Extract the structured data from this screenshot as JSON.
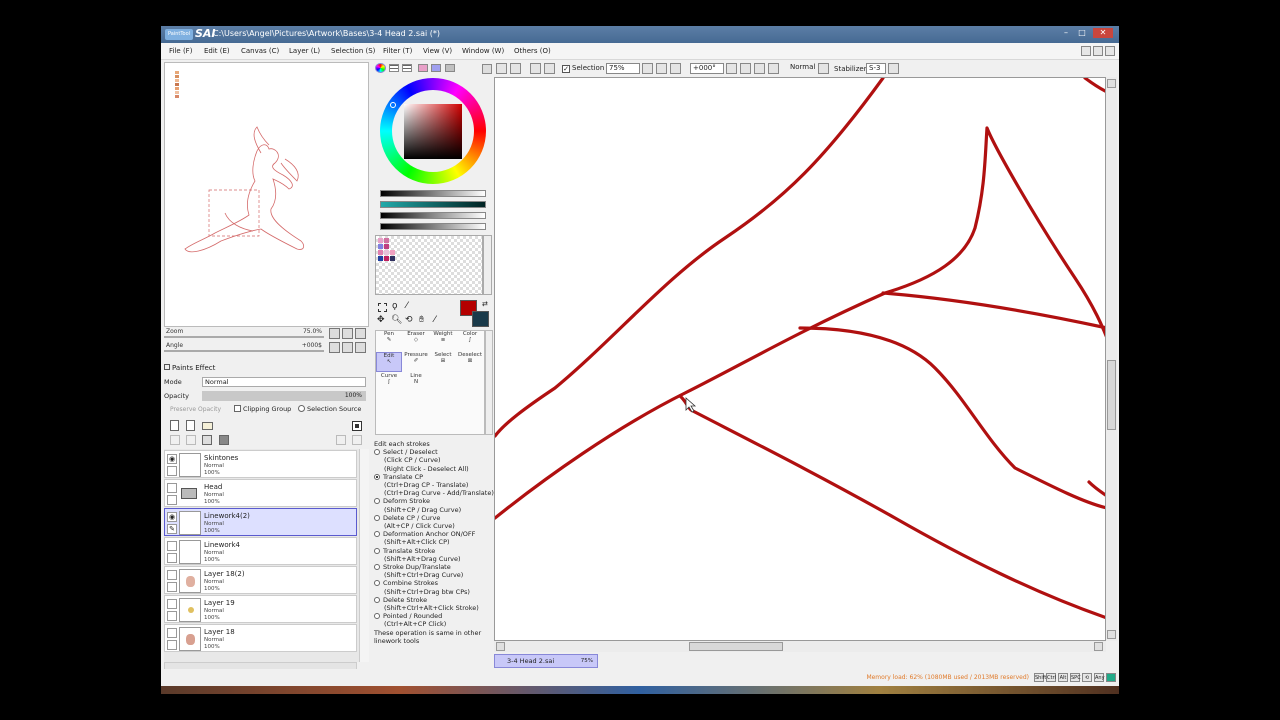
{
  "window": {
    "app_logo_text": "PaintTool",
    "sai_logo_text": "SAI",
    "title": "C:\\Users\\Angel\\Pictures\\Artwork\\Bases\\3-4 Head 2.sai (*)",
    "min_glyph": "–",
    "max_glyph": "□",
    "close_glyph": "✕"
  },
  "menu": [
    {
      "label": "File (F)"
    },
    {
      "label": "Edit (E)"
    },
    {
      "label": "Canvas (C)"
    },
    {
      "label": "Layer (L)"
    },
    {
      "label": "Selection (S)"
    },
    {
      "label": "Filter (T)"
    },
    {
      "label": "View (V)"
    },
    {
      "label": "Window (W)"
    },
    {
      "label": "Others (O)"
    }
  ],
  "navigator": {
    "zoom_label": "Zoom",
    "zoom_value": "75.0%",
    "angle_label": "Angle",
    "angle_value": "+000$"
  },
  "layer_panel": {
    "paints_effect": "Paints Effect",
    "mode_label": "Mode",
    "mode_value": "Normal",
    "opacity_label": "Opacity",
    "opacity_value": "100%",
    "preserve_opacity": "Preserve Opacity",
    "clipping_group": "Clipping Group",
    "selection_source": "Selection Source",
    "layers": [
      {
        "name": "Skintones",
        "mode": "Normal",
        "opacity": "100%",
        "visible": true
      },
      {
        "name": "Head",
        "mode": "Normal",
        "opacity": "100%",
        "visible": false,
        "folder": true
      },
      {
        "name": "Linework4(2)",
        "mode": "Normal",
        "opacity": "100%",
        "visible": true,
        "selected": true
      },
      {
        "name": "Linework4",
        "mode": "Normal",
        "opacity": "100%",
        "visible": false
      },
      {
        "name": "Layer 18(2)",
        "mode": "Normal",
        "opacity": "100%",
        "visible": false
      },
      {
        "name": "Layer 19",
        "mode": "Normal",
        "opacity": "100%",
        "visible": false
      },
      {
        "name": "Layer 18",
        "mode": "Normal",
        "opacity": "100%",
        "visible": false
      }
    ]
  },
  "tools": {
    "row1": [
      {
        "label": "Pen"
      },
      {
        "label": "Eraser"
      },
      {
        "label": "Weight"
      },
      {
        "label": "Color"
      }
    ],
    "row2": [
      {
        "label": "Edit"
      },
      {
        "label": "Pressure"
      },
      {
        "label": "Select"
      },
      {
        "label": "Deselect"
      }
    ],
    "row3": [
      {
        "label": "Curve"
      },
      {
        "label": "Line"
      }
    ]
  },
  "operations": {
    "heading": "Edit each strokes",
    "items": [
      {
        "label": "Select / Deselect",
        "hints": [
          "(Click CP / Curve)",
          "(Right Click - Deselect All)"
        ],
        "selected": false
      },
      {
        "label": "Translate CP",
        "hints": [
          "(Ctrl+Drag CP - Translate)",
          "(Ctrl+Drag Curve - Add/Translate)"
        ],
        "selected": true
      },
      {
        "label": "Deform Stroke",
        "hints": [
          "(Shift+CP / Drag Curve)"
        ],
        "selected": false
      },
      {
        "label": "Delete CP / Curve",
        "hints": [
          "(Alt+CP / Click Curve)"
        ],
        "selected": false
      },
      {
        "label": "Deformation Anchor ON/OFF",
        "hints": [
          "(Shift+Alt+Click CP)"
        ],
        "selected": false
      },
      {
        "label": "Translate Stroke",
        "hints": [
          "(Shift+Alt+Drag Curve)"
        ],
        "selected": false
      },
      {
        "label": "Stroke Dup/Translate",
        "hints": [
          "(Shift+Ctrl+Drag Curve)"
        ],
        "selected": false
      },
      {
        "label": "Combine Strokes",
        "hints": [
          "(Shift+Ctrl+Drag btw CPs)"
        ],
        "selected": false
      },
      {
        "label": "Delete Stroke",
        "hints": [
          "(Shift+Ctrl+Alt+Click Stroke)"
        ],
        "selected": false
      },
      {
        "label": "Pointed / Rounded",
        "hints": [
          "(Ctrl+Alt+CP Click)"
        ],
        "selected": false
      }
    ],
    "footer1": "These operation is same in other",
    "footer2": "linework tools"
  },
  "toolbar": {
    "selection_label": "Selection",
    "zoom": "75%",
    "angle": "+000°",
    "blend": "Normal",
    "stabilizer_label": "Stabilizer",
    "stabilizer_value": "S-3"
  },
  "doc_tab": {
    "name": "3-4 Head 2.sai",
    "zoom": "75%"
  },
  "status": {
    "memory": "Memory load: 62% (1080MB used / 2013MB reserved)",
    "keys": [
      "Shift",
      "Ctrl",
      "Alt",
      "SPC",
      "⟲",
      "Any"
    ]
  },
  "colors": {
    "primary": "#b40000",
    "secondary": "#1a3a4a",
    "stroke": "#b01010",
    "selected_layer": "#dde0ff"
  }
}
